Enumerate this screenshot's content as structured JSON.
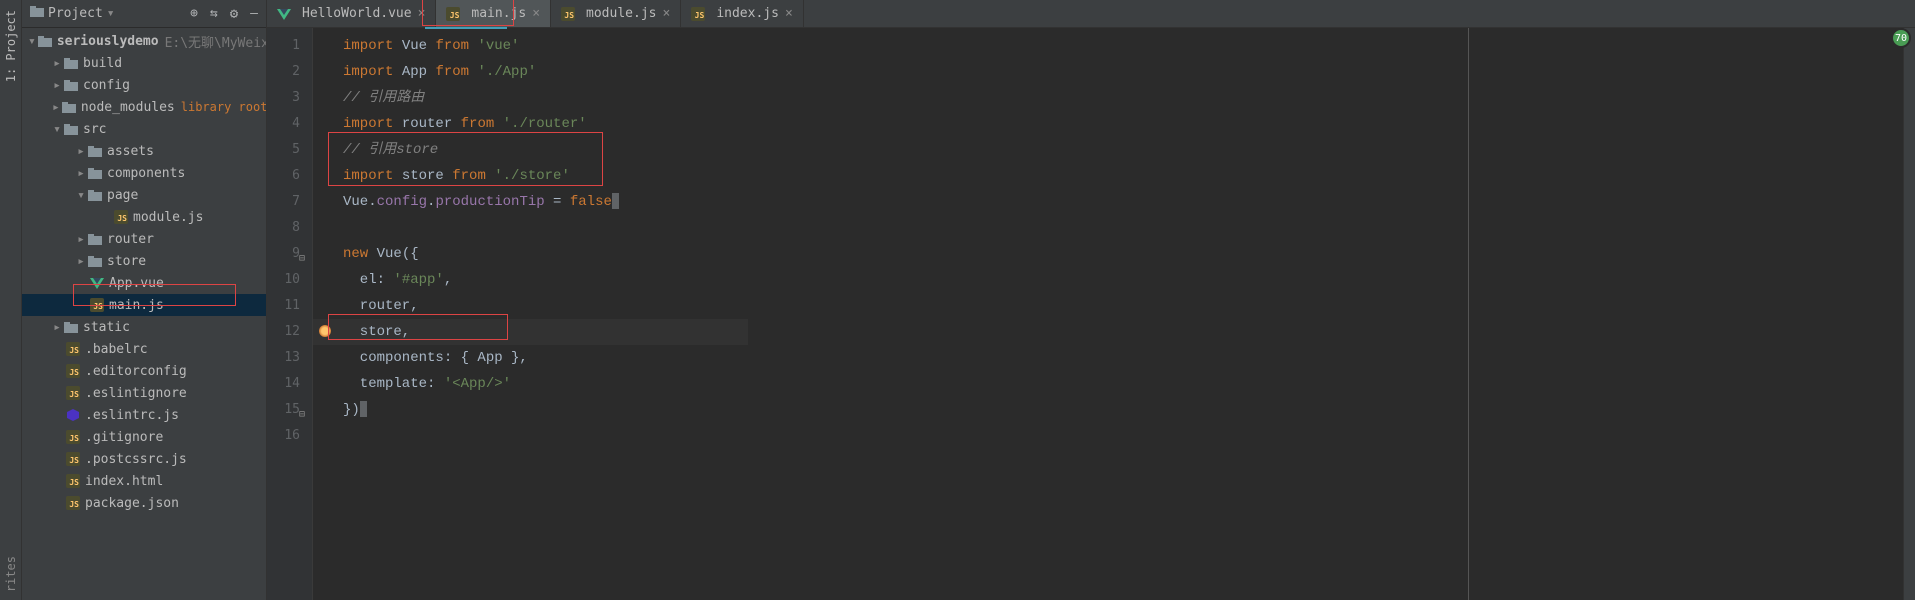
{
  "vtab": {
    "top": "1: Project",
    "bottom": "rites"
  },
  "sidebar": {
    "title": "Project",
    "dropdown": "▾",
    "tools": {
      "target": "⊕",
      "collapse": "⇆",
      "gear": "⚙",
      "shortcut": "―"
    }
  },
  "tree": {
    "root": {
      "name": "seriouslydemo",
      "path": "E:\\无聊\\MyWeixin\\seriouslydemo"
    },
    "build": "build",
    "config": "config",
    "node_modules": {
      "name": "node_modules",
      "tag": "library root"
    },
    "src": "src",
    "assets": "assets",
    "components": "components",
    "page": "page",
    "modulejs": "module.js",
    "router": "router",
    "store": "store",
    "appvue": "App.vue",
    "mainjs": "main.js",
    "static": "static",
    "babelrc": ".babelrc",
    "editorconfig": ".editorconfig",
    "eslintignore": ".eslintignore",
    "eslintrc": ".eslintrc.js",
    "gitignore": ".gitignore",
    "postcssrc": ".postcssrc.js",
    "indexhtml": "index.html",
    "packagejson": "package.json"
  },
  "tabs": {
    "t1": "HelloWorld.vue",
    "t2": "main.js",
    "t3": "module.js",
    "t4": "index.js"
  },
  "code": {
    "l1": {
      "a": "import",
      "b": " Vue ",
      "c": "from",
      "d": " 'vue'"
    },
    "l2": {
      "a": "import",
      "b": " App ",
      "c": "from",
      "d": " './App'"
    },
    "l3": {
      "a": "// 引用路由"
    },
    "l4": {
      "a": "import",
      "b": " router ",
      "c": "from",
      "d": " './router'"
    },
    "l5": {
      "a": "// 引用store"
    },
    "l6": {
      "a": "import",
      "b": " store ",
      "c": "from",
      "d": " './store'"
    },
    "l7": {
      "a": "Vue.",
      "b": "config",
      "c": ".",
      "d": "productionTip",
      "e": " = ",
      "f": "false"
    },
    "l9": {
      "a": "new",
      "b": " Vue({"
    },
    "l10": {
      "a": "  el: ",
      "b": "'#app'",
      "c": ","
    },
    "l11": {
      "a": "  router,"
    },
    "l12": {
      "a": "  store,"
    },
    "l13": {
      "a": "  components: { App },"
    },
    "l14": {
      "a": "  template: ",
      "b": "'<App/>'"
    },
    "l15": {
      "a": "})"
    }
  },
  "badge": "70"
}
